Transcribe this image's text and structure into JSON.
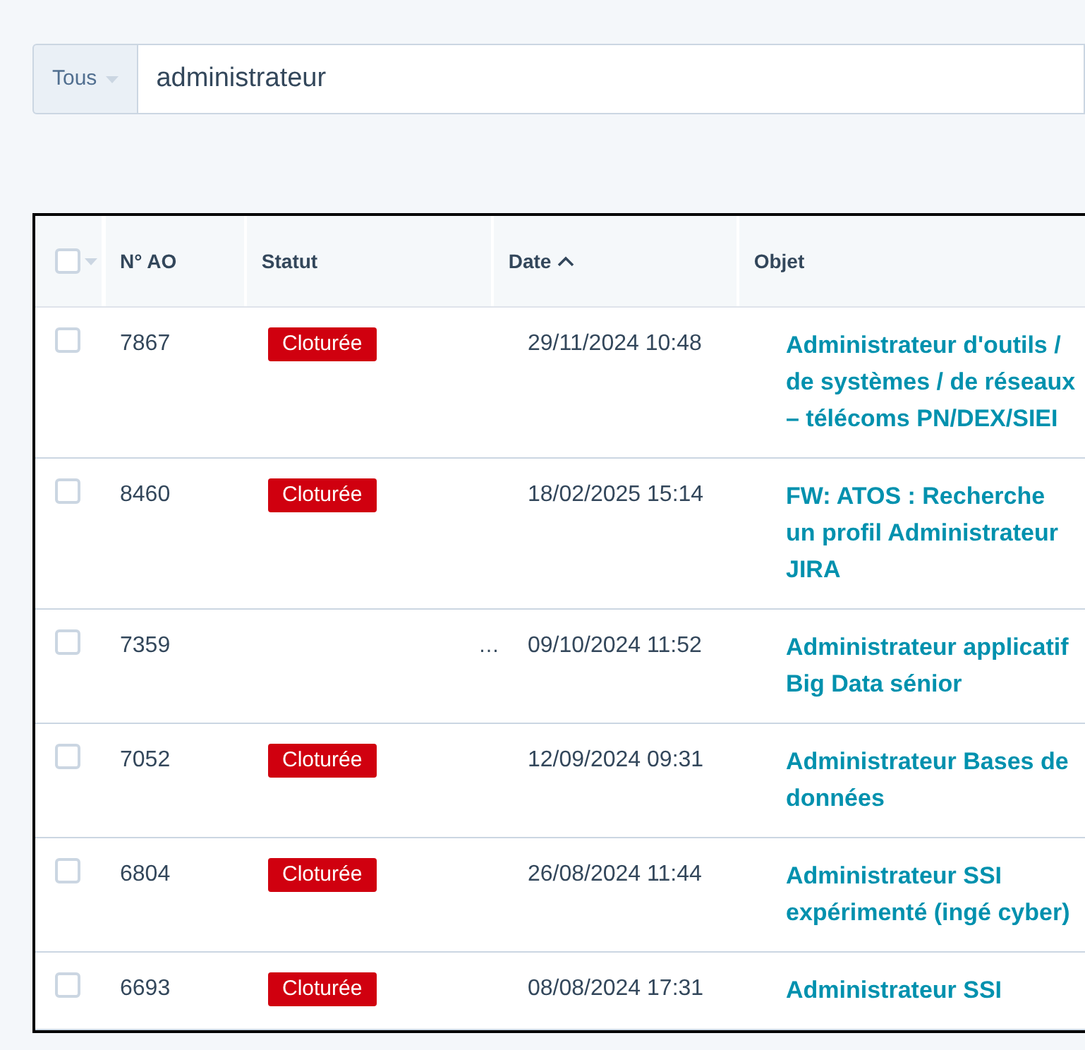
{
  "search": {
    "scope": "Tous",
    "value": "administrateur"
  },
  "table": {
    "columns": [
      {
        "label": "N° AO",
        "sorted": false
      },
      {
        "label": "Statut",
        "sorted": false
      },
      {
        "label": "Date",
        "sorted": true
      },
      {
        "label": "Objet",
        "sorted": false
      }
    ],
    "select_all": {
      "checked": false
    },
    "rows": [
      {
        "checked": false,
        "number": "7867",
        "status": {
          "kind": "badge",
          "label": "Cloturée"
        },
        "date": "29/11/2024 10:48",
        "object": "Administrateur d'outils / de systèmes / de réseaux – télécoms PN/DEX/SIEI"
      },
      {
        "checked": false,
        "number": "8460",
        "status": {
          "kind": "badge",
          "label": "Cloturée"
        },
        "date": "18/02/2025 15:14",
        "object": "FW: ATOS : Recherche un profil Administrateur JIRA"
      },
      {
        "checked": false,
        "number": "7359",
        "status": {
          "kind": "text",
          "label": "…"
        },
        "date": "09/10/2024 11:52",
        "object": "Administrateur applicatif Big Data sénior"
      },
      {
        "checked": false,
        "number": "7052",
        "status": {
          "kind": "badge",
          "label": "Cloturée"
        },
        "date": "12/09/2024 09:31",
        "object": "Administrateur Bases de données"
      },
      {
        "checked": false,
        "number": "6804",
        "status": {
          "kind": "badge",
          "label": "Cloturée"
        },
        "date": "26/08/2024 11:44",
        "object": "Administrateur SSI expérimenté (ingé cyber)"
      },
      {
        "checked": false,
        "number": "6693",
        "status": {
          "kind": "badge",
          "label": "Cloturée"
        },
        "date": "08/08/2024 17:31",
        "object": "Administrateur SSI"
      }
    ]
  }
}
